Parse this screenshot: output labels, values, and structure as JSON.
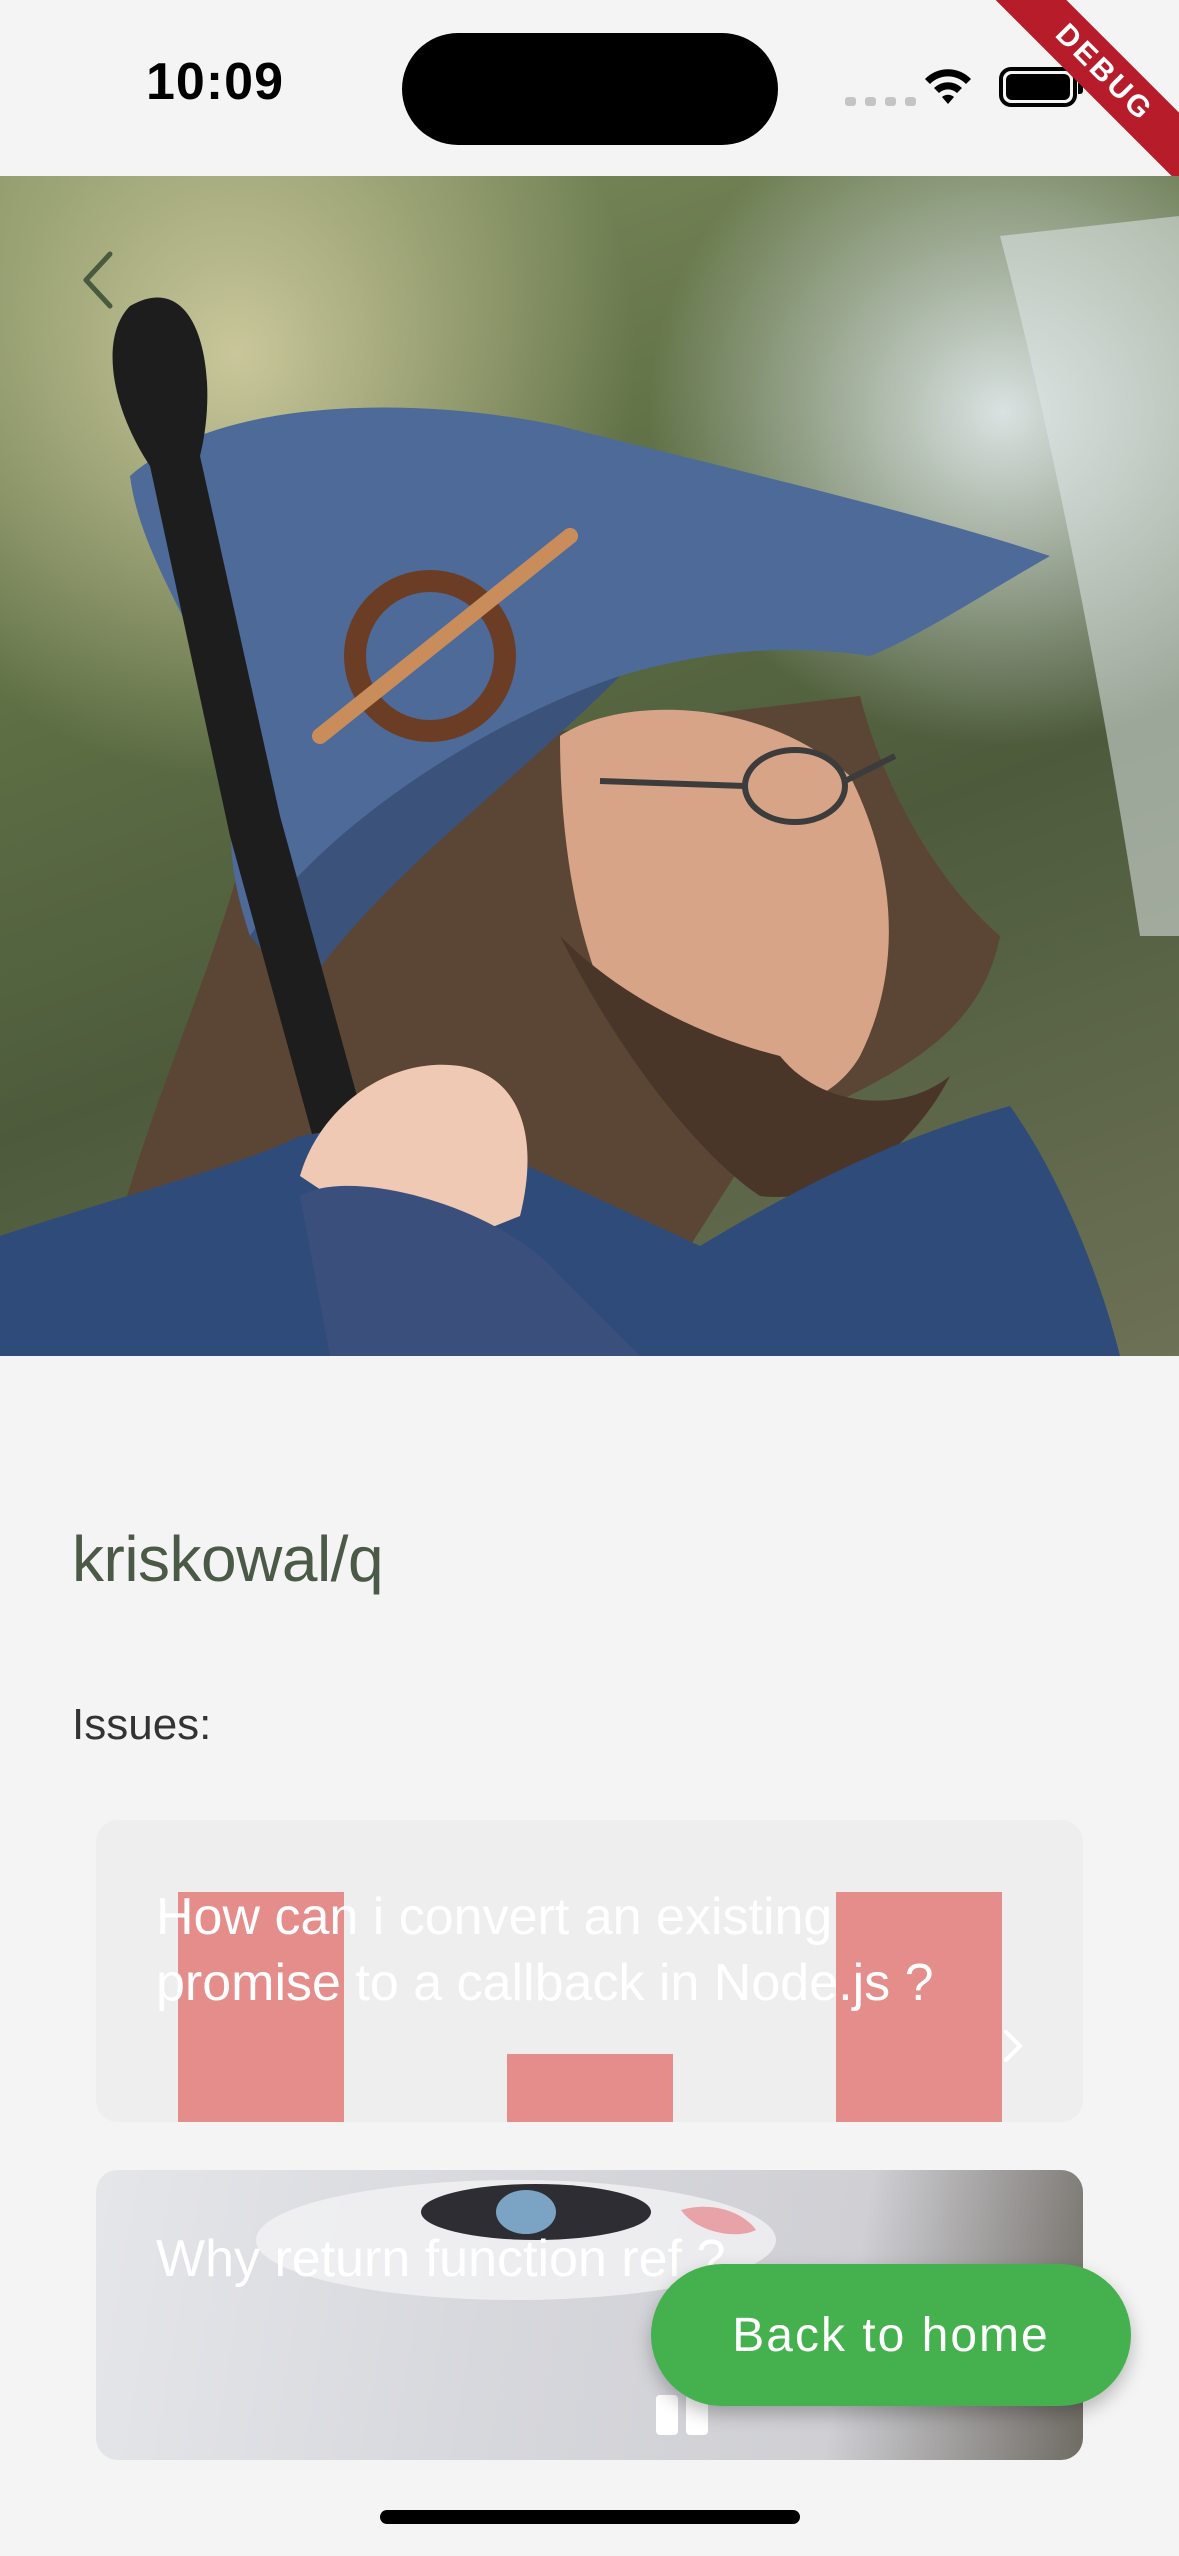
{
  "status_bar": {
    "time": "10:09"
  },
  "debug_banner": "DEBUG",
  "repo": {
    "name": "kriskowal/q"
  },
  "issues_label": "Issues:",
  "issues": [
    {
      "title": "How can i convert an existing promise  to a callback in Node.js ?"
    },
    {
      "title": "Why return function ref ?"
    }
  ],
  "fab": {
    "label": "Back to home"
  },
  "icons": {
    "back": "chevron-left-icon",
    "row_chevron": "chevron-right-icon",
    "wifi": "wifi-icon",
    "battery": "battery-icon"
  },
  "colors": {
    "accent_green": "#45b14e",
    "title_color": "#4b5a46",
    "bar_color": "#e48d8a"
  }
}
